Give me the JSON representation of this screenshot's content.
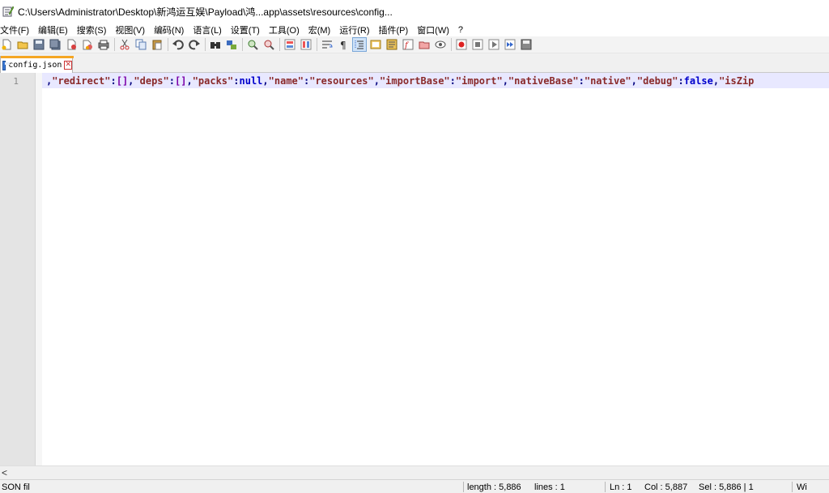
{
  "window": {
    "title": "C:\\Users\\Administrator\\Desktop\\新鸿运互娱\\Payload\\鸿...app\\assets\\resources\\config..."
  },
  "menu": {
    "items": [
      "文件(F)",
      "编辑(E)",
      "搜索(S)",
      "视图(V)",
      "编码(N)",
      "语言(L)",
      "设置(T)",
      "工具(O)",
      "宏(M)",
      "运行(R)",
      "插件(P)",
      "窗口(W)",
      "?"
    ]
  },
  "toolbar": {
    "icons": [
      "new-file-icon",
      "open-file-icon",
      "save-icon",
      "save-all-icon",
      "close-icon",
      "close-all-icon",
      "print-icon",
      "cut-icon",
      "copy-icon",
      "paste-icon",
      "undo-icon",
      "redo-icon",
      "find-icon",
      "replace-icon",
      "zoom-in-icon",
      "zoom-out-icon",
      "sync-vertical-icon",
      "sync-horizontal-icon",
      "word-wrap-icon",
      "show-all-chars-icon",
      "indent-guide-icon",
      "user-lang-icon",
      "doc-map-icon",
      "function-list-icon",
      "folder-workspace-icon",
      "monitoring-icon",
      "record-macro-icon",
      "stop-record-icon",
      "play-macro-icon",
      "run-macro-multiple-icon",
      "save-macro-icon"
    ]
  },
  "tab": {
    "label": "config.json",
    "close": "✕"
  },
  "editor": {
    "line_number": "1",
    "tokens": [
      {
        "t": ",",
        "c": "op"
      },
      {
        "t": "\"redirect\"",
        "c": "str"
      },
      {
        "t": ":",
        "c": "op"
      },
      {
        "t": "[]",
        "c": "br"
      },
      {
        "t": ",",
        "c": "op"
      },
      {
        "t": "\"deps\"",
        "c": "str"
      },
      {
        "t": ":",
        "c": "op"
      },
      {
        "t": "[]",
        "c": "br"
      },
      {
        "t": ",",
        "c": "op"
      },
      {
        "t": "\"packs\"",
        "c": "str"
      },
      {
        "t": ":",
        "c": "op"
      },
      {
        "t": "null",
        "c": "kw"
      },
      {
        "t": ",",
        "c": "op"
      },
      {
        "t": "\"name\"",
        "c": "str"
      },
      {
        "t": ":",
        "c": "op"
      },
      {
        "t": "\"resources\"",
        "c": "str"
      },
      {
        "t": ",",
        "c": "op"
      },
      {
        "t": "\"importBase\"",
        "c": "str"
      },
      {
        "t": ":",
        "c": "op"
      },
      {
        "t": "\"import\"",
        "c": "str"
      },
      {
        "t": ",",
        "c": "op"
      },
      {
        "t": "\"nativeBase\"",
        "c": "str"
      },
      {
        "t": ":",
        "c": "op"
      },
      {
        "t": "\"native\"",
        "c": "str"
      },
      {
        "t": ",",
        "c": "op"
      },
      {
        "t": "\"debug\"",
        "c": "str"
      },
      {
        "t": ":",
        "c": "op"
      },
      {
        "t": "false",
        "c": "kw"
      },
      {
        "t": ",",
        "c": "op"
      },
      {
        "t": "\"isZip",
        "c": "str"
      }
    ]
  },
  "scrollbar": {
    "left_arrow": "<"
  },
  "status": {
    "filetype": "SON fil",
    "length": "length : 5,886",
    "lines": "lines : 1",
    "ln": "Ln : 1",
    "col": "Col : 5,887",
    "sel": "Sel : 5,886 | 1",
    "eol": "Wi"
  }
}
